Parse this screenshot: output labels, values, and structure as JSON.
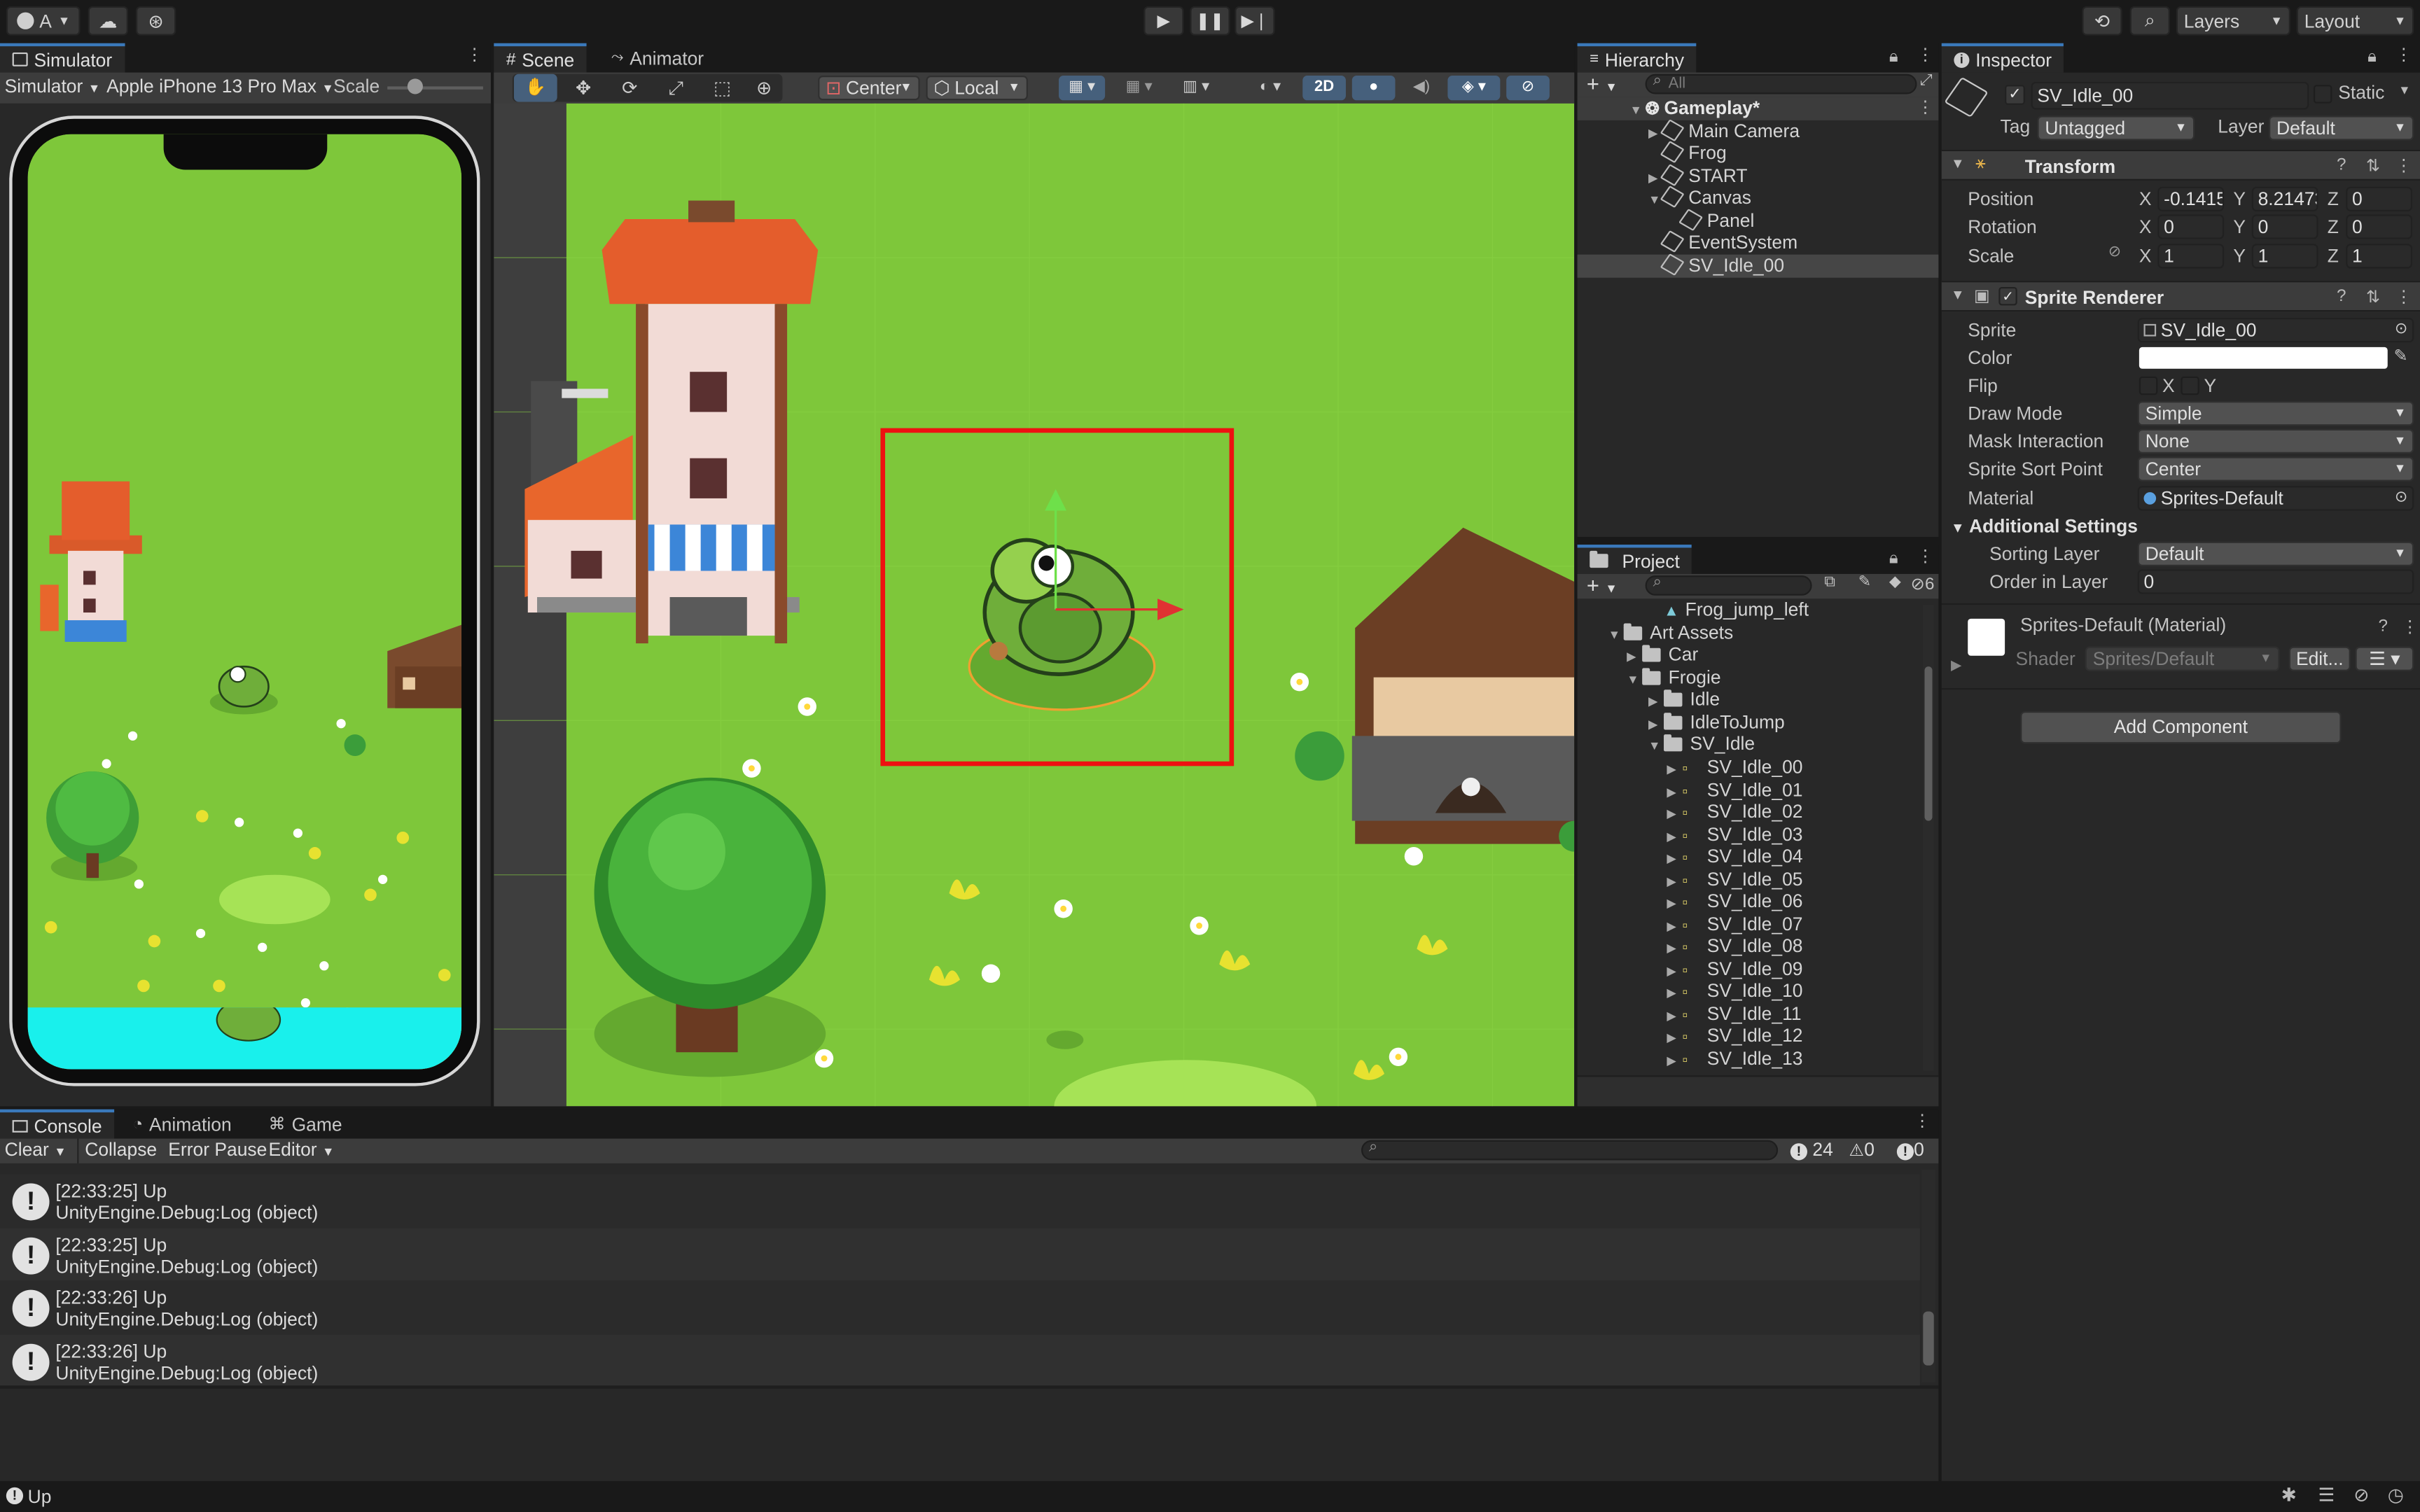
{
  "toolbar": {
    "account": "A",
    "layers": "Layers",
    "layout": "Layout"
  },
  "simulator": {
    "tab": "Simulator",
    "mode": "Simulator",
    "device": "Apple iPhone 13 Pro Max",
    "scale_label": "Scale",
    "scale_value": 0.25
  },
  "scene": {
    "tabs": [
      "Scene",
      "Animator"
    ],
    "pivot": "Center",
    "space": "Local",
    "mode_2d": "2D"
  },
  "hierarchy": {
    "tab": "Hierarchy",
    "search_placeholder": "All",
    "scene_name": "Gameplay*",
    "items": [
      {
        "label": "Main Camera"
      },
      {
        "label": "Frog"
      },
      {
        "label": "START"
      },
      {
        "label": "Canvas"
      },
      {
        "label": "Panel"
      },
      {
        "label": "EventSystem"
      },
      {
        "label": "SV_Idle_00"
      }
    ]
  },
  "project": {
    "tab": "Project",
    "hidden_count": "6",
    "items": [
      {
        "label": "Frog_jump_left"
      },
      {
        "label": "Art Assets"
      },
      {
        "label": "Car"
      },
      {
        "label": "Frogie"
      },
      {
        "label": "Idle"
      },
      {
        "label": "IdleToJump"
      },
      {
        "label": "SV_Idle"
      }
    ],
    "sprites": [
      "SV_Idle_00",
      "SV_Idle_01",
      "SV_Idle_02",
      "SV_Idle_03",
      "SV_Idle_04",
      "SV_Idle_05",
      "SV_Idle_06",
      "SV_Idle_07",
      "SV_Idle_08",
      "SV_Idle_09",
      "SV_Idle_10",
      "SV_Idle_11",
      "SV_Idle_12",
      "SV_Idle_13"
    ]
  },
  "inspector": {
    "tab": "Inspector",
    "object_name": "SV_Idle_00",
    "static_label": "Static",
    "tag_label": "Tag",
    "tag_value": "Untagged",
    "layer_label": "Layer",
    "layer_value": "Default",
    "transform": {
      "title": "Transform",
      "position_label": "Position",
      "rotation_label": "Rotation",
      "scale_label": "Scale",
      "pos_x": "-0.1415",
      "pos_y": "8.21473",
      "pos_z": "0",
      "rot_x": "0",
      "rot_y": "0",
      "rot_z": "0",
      "scl_x": "1",
      "scl_y": "1",
      "scl_z": "1",
      "x": "X",
      "y": "Y",
      "z": "Z"
    },
    "sprite_renderer": {
      "title": "Sprite Renderer",
      "sprite_label": "Sprite",
      "sprite_value": "SV_Idle_00",
      "color_label": "Color",
      "flip_label": "Flip",
      "flip_x": "X",
      "flip_y": "Y",
      "draw_mode_label": "Draw Mode",
      "draw_mode_value": "Simple",
      "mask_label": "Mask Interaction",
      "mask_value": "None",
      "sort_point_label": "Sprite Sort Point",
      "sort_point_value": "Center",
      "material_label": "Material",
      "material_value": "Sprites-Default",
      "additional_label": "Additional Settings",
      "sorting_layer_label": "Sorting Layer",
      "sorting_layer_value": "Default",
      "order_label": "Order in Layer",
      "order_value": "0"
    },
    "material": {
      "title": "Sprites-Default (Material)",
      "shader_label": "Shader",
      "shader_value": "Sprites/Default",
      "edit_label": "Edit..."
    },
    "add_component": "Add Component"
  },
  "console": {
    "tabs": [
      "Console",
      "Animation",
      "Game"
    ],
    "clear": "Clear",
    "collapse": "Collapse",
    "error_pause": "Error Pause",
    "editor": "Editor",
    "count_log": "24",
    "count_warn": "0",
    "count_err": "0",
    "entries": [
      {
        "time": "[22:33:25] Up",
        "detail": "UnityEngine.Debug:Log (object)"
      },
      {
        "time": "[22:33:25] Up",
        "detail": "UnityEngine.Debug:Log (object)"
      },
      {
        "time": "[22:33:26] Up",
        "detail": "UnityEngine.Debug:Log (object)"
      },
      {
        "time": "[22:33:26] Up",
        "detail": "UnityEngine.Debug:Log (object)"
      }
    ]
  },
  "status": {
    "text": "Up"
  },
  "colors": {
    "accent": "#3a79bb",
    "grass": "#7ec73a",
    "water": "#19f0ec",
    "selection_box": "#ee1111"
  }
}
